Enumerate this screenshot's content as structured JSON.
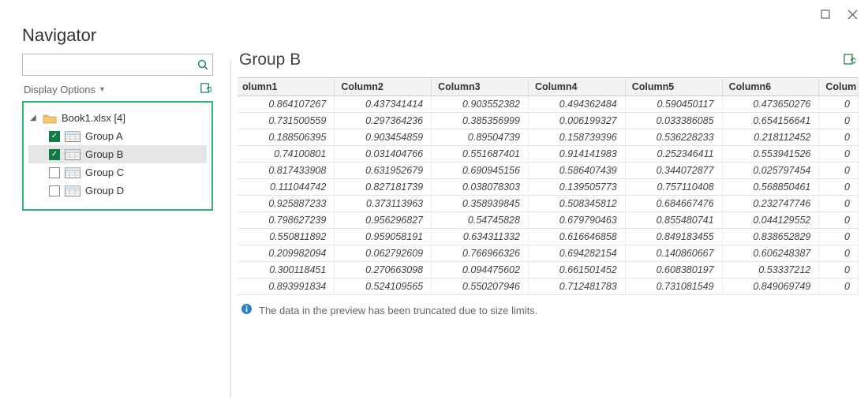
{
  "title": "Navigator",
  "search": {
    "value": "",
    "placeholder": ""
  },
  "displayOptions": "Display Options",
  "tree": {
    "root": "Book1.xlsx [4]",
    "items": [
      {
        "label": "Group A",
        "checked": true,
        "selected": false
      },
      {
        "label": "Group B",
        "checked": true,
        "selected": true
      },
      {
        "label": "Group C",
        "checked": false,
        "selected": false
      },
      {
        "label": "Group D",
        "checked": false,
        "selected": false
      }
    ]
  },
  "preview": {
    "title": "Group B",
    "columns": [
      "olumn1",
      "Column2",
      "Column3",
      "Column4",
      "Column5",
      "Column6",
      "Colum"
    ],
    "rows": [
      [
        "0.864107267",
        "0.437341414",
        "0.903552382",
        "0.494362484",
        "0.590450117",
        "0.473650276",
        "0"
      ],
      [
        "0.731500559",
        "0.297364236",
        "0.385356999",
        "0.006199327",
        "0.033386085",
        "0.654156641",
        "0"
      ],
      [
        "0.188506395",
        "0.903454859",
        "0.89504739",
        "0.158739396",
        "0.536228233",
        "0.218112452",
        "0"
      ],
      [
        "0.74100801",
        "0.031404766",
        "0.551687401",
        "0.914141983",
        "0.252346411",
        "0.553941526",
        "0"
      ],
      [
        "0.817433908",
        "0.631952679",
        "0.690945156",
        "0.586407439",
        "0.344072877",
        "0.025797454",
        "0"
      ],
      [
        "0.111044742",
        "0.827181739",
        "0.038078303",
        "0.139505773",
        "0.757110408",
        "0.568850461",
        "0"
      ],
      [
        "0.925887233",
        "0.373113963",
        "0.358939845",
        "0.508345812",
        "0.684667476",
        "0.232747746",
        "0"
      ],
      [
        "0.798627239",
        "0.956296827",
        "0.54745828",
        "0.679790463",
        "0.855480741",
        "0.044129552",
        "0"
      ],
      [
        "0.550811892",
        "0.959058191",
        "0.634311332",
        "0.616646858",
        "0.849183455",
        "0.838652829",
        "0"
      ],
      [
        "0.209982094",
        "0.062792609",
        "0.766966326",
        "0.694282154",
        "0.140860667",
        "0.606248387",
        "0"
      ],
      [
        "0.300118451",
        "0.270663098",
        "0.094475602",
        "0.661501452",
        "0.608380197",
        "0.53337212",
        "0"
      ],
      [
        "0.893991834",
        "0.524109565",
        "0.550207946",
        "0.712481783",
        "0.731081549",
        "0.849069749",
        "0"
      ]
    ],
    "truncatedMessage": "The data in the preview has been truncated due to size limits."
  }
}
